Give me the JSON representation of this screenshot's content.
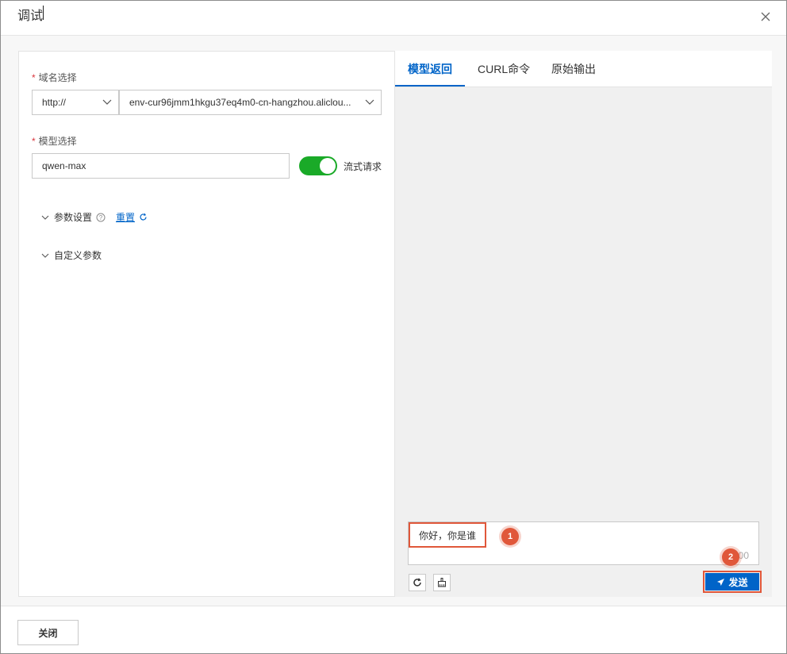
{
  "dialog": {
    "title": "调试",
    "close_icon": "close-icon"
  },
  "form": {
    "domain": {
      "label": "域名选择",
      "required_mark": "*",
      "protocol_value": "http://",
      "domain_value": "env-cur96jmm1hkgu37eq4m0-cn-hangzhou.aliclou..."
    },
    "model": {
      "label": "模型选择",
      "required_mark": "*",
      "value": "qwen-max",
      "stream_label": "流式请求",
      "stream_enabled": true
    },
    "param_settings": {
      "label": "参数设置",
      "reset_label": "重置"
    },
    "custom_params": {
      "label": "自定义参数"
    }
  },
  "result": {
    "tabs": [
      {
        "label": "模型返回",
        "active": true
      },
      {
        "label": "CURL命令",
        "active": false
      },
      {
        "label": "原始输出",
        "active": false
      }
    ],
    "chat_input_value": "你好，你是谁",
    "char_counter": "00",
    "send_label": "发送",
    "markers": [
      "1",
      "2"
    ]
  },
  "footer": {
    "close_label": "关闭"
  },
  "colors": {
    "accent": "#0064c8",
    "switch_on": "#1aaa28",
    "highlight": "#e0573a",
    "required": "#d9363e"
  }
}
